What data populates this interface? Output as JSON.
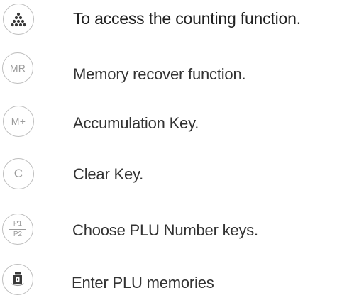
{
  "rows": [
    {
      "icon": "counting-icon",
      "key_label": "",
      "text": "To access the counting function."
    },
    {
      "icon": "",
      "key_label": "MR",
      "text": "Memory recover function."
    },
    {
      "icon": "",
      "key_label": "M+",
      "text": "Accumulation Key."
    },
    {
      "icon": "",
      "key_label": "C",
      "text": "Clear Key."
    },
    {
      "icon": "",
      "key_top": "P1",
      "key_bottom": "P2",
      "text": "Choose PLU Number keys."
    },
    {
      "icon": "weight-icon",
      "key_label": "",
      "text": "Enter PLU memories"
    }
  ]
}
